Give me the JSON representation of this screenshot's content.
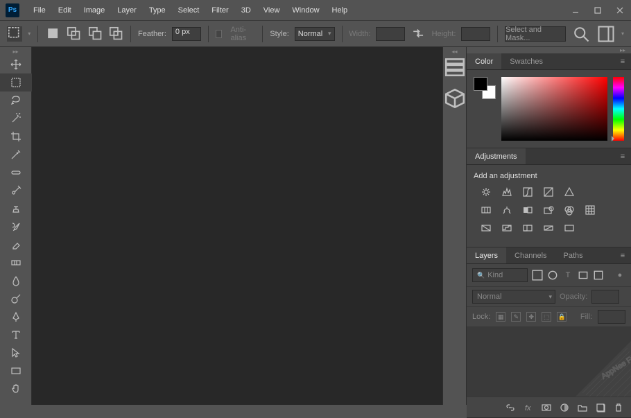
{
  "menu": [
    "File",
    "Edit",
    "Image",
    "Layer",
    "Type",
    "Select",
    "Filter",
    "3D",
    "View",
    "Window",
    "Help"
  ],
  "options": {
    "feather_label": "Feather:",
    "feather_value": "0 px",
    "antialias_label": "Anti-alias",
    "style_label": "Style:",
    "style_value": "Normal",
    "width_label": "Width:",
    "height_label": "Height:",
    "select_mask": "Select and Mask..."
  },
  "panels": {
    "color_tab": "Color",
    "swatches_tab": "Swatches",
    "adjustments_tab": "Adjustments",
    "adj_title": "Add an adjustment",
    "layers_tab": "Layers",
    "channels_tab": "Channels",
    "paths_tab": "Paths",
    "kind": "Kind",
    "blend": "Normal",
    "opacity_label": "Opacity:",
    "lock_label": "Lock:",
    "fill_label": "Fill:"
  },
  "colors": {
    "foreground": "#000000",
    "background": "#ffffff",
    "hue": "#ff0000"
  },
  "watermark": "AppNee Freeware Group"
}
